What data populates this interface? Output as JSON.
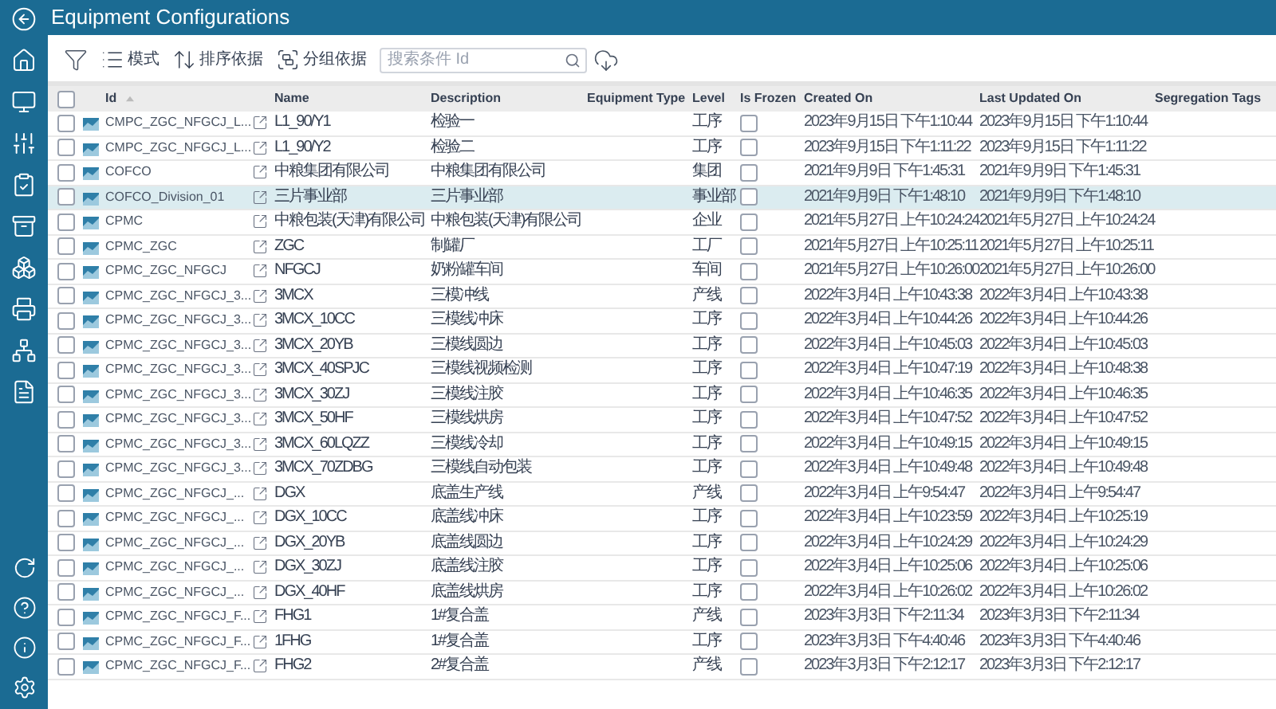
{
  "window": {
    "title": "Equipment Configurations"
  },
  "toolbar": {
    "mode_label": "模式",
    "sort_label": "排序依据",
    "group_label": "分组依据",
    "search": {
      "placeholder": "搜索条件 Id"
    }
  },
  "table": {
    "all_checked": false,
    "columns": [
      "Id",
      "Name",
      "Description",
      "Equipment Type",
      "Level",
      "Is Frozen",
      "Created On",
      "Last Updated On",
      "Segregation Tags"
    ],
    "rows": [
      {
        "id": "CMPC_ZGC_NFGCJ_L...",
        "name": "L1_90/Y1",
        "description": "检验一",
        "level": "工序",
        "created_on": "2023年9月15日 下午1:10:44",
        "last_updated_on": "2023年9月15日 下午1:10:44",
        "selected": false,
        "checked": false,
        "frozen": false
      },
      {
        "id": "CMPC_ZGC_NFGCJ_L...",
        "name": "L1_90/Y2",
        "description": "检验二",
        "level": "工序",
        "created_on": "2023年9月15日 下午1:11:22",
        "last_updated_on": "2023年9月15日 下午1:11:22",
        "selected": false,
        "checked": false,
        "frozen": false
      },
      {
        "id": "COFCO",
        "name": "中粮集团有限公司",
        "description": "中粮集团有限公司",
        "level": "集团",
        "created_on": "2021年9月9日 下午1:45:31",
        "last_updated_on": "2021年9月9日 下午1:45:31",
        "selected": false,
        "checked": false,
        "frozen": false
      },
      {
        "id": "COFCO_Division_01",
        "name": "三片事业部",
        "description": "三片事业部",
        "level": "事业部",
        "created_on": "2021年9月9日 下午1:48:10",
        "last_updated_on": "2021年9月9日 下午1:48:10",
        "selected": true,
        "checked": false,
        "frozen": false
      },
      {
        "id": "CPMC",
        "name": "中粮包装(天津)有限公司",
        "description": "中粮包装(天津)有限公司",
        "level": "企业",
        "created_on": "2021年5月27日 上午10:24:24",
        "last_updated_on": "2021年5月27日 上午10:24:24",
        "selected": false,
        "checked": false,
        "frozen": false
      },
      {
        "id": "CPMC_ZGC",
        "name": "ZGC",
        "description": "制罐厂",
        "level": "工厂",
        "created_on": "2021年5月27日 上午10:25:11",
        "last_updated_on": "2021年5月27日 上午10:25:11",
        "selected": false,
        "checked": false,
        "frozen": false
      },
      {
        "id": "CPMC_ZGC_NFGCJ",
        "name": "NFGCJ",
        "description": "奶粉罐车间",
        "level": "车间",
        "created_on": "2021年5月27日 上午10:26:00",
        "last_updated_on": "2021年5月27日 上午10:26:00",
        "selected": false,
        "checked": false,
        "frozen": false
      },
      {
        "id": "CPMC_ZGC_NFGCJ_3...",
        "name": "3MCX",
        "description": "三模冲线",
        "level": "产线",
        "created_on": "2022年3月4日 上午10:43:38",
        "last_updated_on": "2022年3月4日 上午10:43:38",
        "selected": false,
        "checked": false,
        "frozen": false
      },
      {
        "id": "CPMC_ZGC_NFGCJ_3...",
        "name": "3MCX_10CC",
        "description": "三模线冲床",
        "level": "工序",
        "created_on": "2022年3月4日 上午10:44:26",
        "last_updated_on": "2022年3月4日 上午10:44:26",
        "selected": false,
        "checked": false,
        "frozen": false
      },
      {
        "id": "CPMC_ZGC_NFGCJ_3...",
        "name": "3MCX_20YB",
        "description": "三模线圆边",
        "level": "工序",
        "created_on": "2022年3月4日 上午10:45:03",
        "last_updated_on": "2022年3月4日 上午10:45:03",
        "selected": false,
        "checked": false,
        "frozen": false
      },
      {
        "id": "CPMC_ZGC_NFGCJ_3...",
        "name": "3MCX_40SPJC",
        "description": "三模线视频检测",
        "level": "工序",
        "created_on": "2022年3月4日 上午10:47:19",
        "last_updated_on": "2022年3月4日 上午10:48:38",
        "selected": false,
        "checked": false,
        "frozen": false
      },
      {
        "id": "CPMC_ZGC_NFGCJ_3...",
        "name": "3MCX_30ZJ",
        "description": "三模线注胶",
        "level": "工序",
        "created_on": "2022年3月4日 上午10:46:35",
        "last_updated_on": "2022年3月4日 上午10:46:35",
        "selected": false,
        "checked": false,
        "frozen": false
      },
      {
        "id": "CPMC_ZGC_NFGCJ_3...",
        "name": "3MCX_50HF",
        "description": "三模线烘房",
        "level": "工序",
        "created_on": "2022年3月4日 上午10:47:52",
        "last_updated_on": "2022年3月4日 上午10:47:52",
        "selected": false,
        "checked": false,
        "frozen": false
      },
      {
        "id": "CPMC_ZGC_NFGCJ_3...",
        "name": "3MCX_60LQZZ",
        "description": "三模线冷却",
        "level": "工序",
        "created_on": "2022年3月4日 上午10:49:15",
        "last_updated_on": "2022年3月4日 上午10:49:15",
        "selected": false,
        "checked": false,
        "frozen": false
      },
      {
        "id": "CPMC_ZGC_NFGCJ_3...",
        "name": "3MCX_70ZDBG",
        "description": "三模线自动包装",
        "level": "工序",
        "created_on": "2022年3月4日 上午10:49:48",
        "last_updated_on": "2022年3月4日 上午10:49:48",
        "selected": false,
        "checked": false,
        "frozen": false
      },
      {
        "id": "CPMC_ZGC_NFGCJ_...",
        "name": "DGX",
        "description": "底盖生产线",
        "level": "产线",
        "created_on": "2022年3月4日 上午9:54:47",
        "last_updated_on": "2022年3月4日 上午9:54:47",
        "selected": false,
        "checked": false,
        "frozen": false
      },
      {
        "id": "CPMC_ZGC_NFGCJ_...",
        "name": "DGX_10CC",
        "description": "底盖线冲床",
        "level": "工序",
        "created_on": "2022年3月4日 上午10:23:59",
        "last_updated_on": "2022年3月4日 上午10:25:19",
        "selected": false,
        "checked": false,
        "frozen": false
      },
      {
        "id": "CPMC_ZGC_NFGCJ_...",
        "name": "DGX_20YB",
        "description": "底盖线圆边",
        "level": "工序",
        "created_on": "2022年3月4日 上午10:24:29",
        "last_updated_on": "2022年3月4日 上午10:24:29",
        "selected": false,
        "checked": false,
        "frozen": false
      },
      {
        "id": "CPMC_ZGC_NFGCJ_...",
        "name": "DGX_30ZJ",
        "description": "底盖线注胶",
        "level": "工序",
        "created_on": "2022年3月4日 上午10:25:06",
        "last_updated_on": "2022年3月4日 上午10:25:06",
        "selected": false,
        "checked": false,
        "frozen": false
      },
      {
        "id": "CPMC_ZGC_NFGCJ_...",
        "name": "DGX_40HF",
        "description": "底盖线烘房",
        "level": "工序",
        "created_on": "2022年3月4日 上午10:26:02",
        "last_updated_on": "2022年3月4日 上午10:26:02",
        "selected": false,
        "checked": false,
        "frozen": false
      },
      {
        "id": "CPMC_ZGC_NFGCJ_F...",
        "name": "FHG1",
        "description": "1#复合盖",
        "level": "产线",
        "created_on": "2023年3月3日 下午2:11:34",
        "last_updated_on": "2023年3月3日 下午2:11:34",
        "selected": false,
        "checked": false,
        "frozen": false
      },
      {
        "id": "CPMC_ZGC_NFGCJ_F...",
        "name": "1FHG",
        "description": "1#复合盖",
        "level": "工序",
        "created_on": "2023年3月3日 下午4:40:46",
        "last_updated_on": "2023年3月3日 下午4:40:46",
        "selected": false,
        "checked": false,
        "frozen": false
      },
      {
        "id": "CPMC_ZGC_NFGCJ_F...",
        "name": "FHG2",
        "description": "2#复合盖",
        "level": "产线",
        "created_on": "2023年3月3日 下午2:12:17",
        "last_updated_on": "2023年3月3日 下午2:12:17",
        "selected": false,
        "checked": false,
        "frozen": false
      }
    ]
  }
}
